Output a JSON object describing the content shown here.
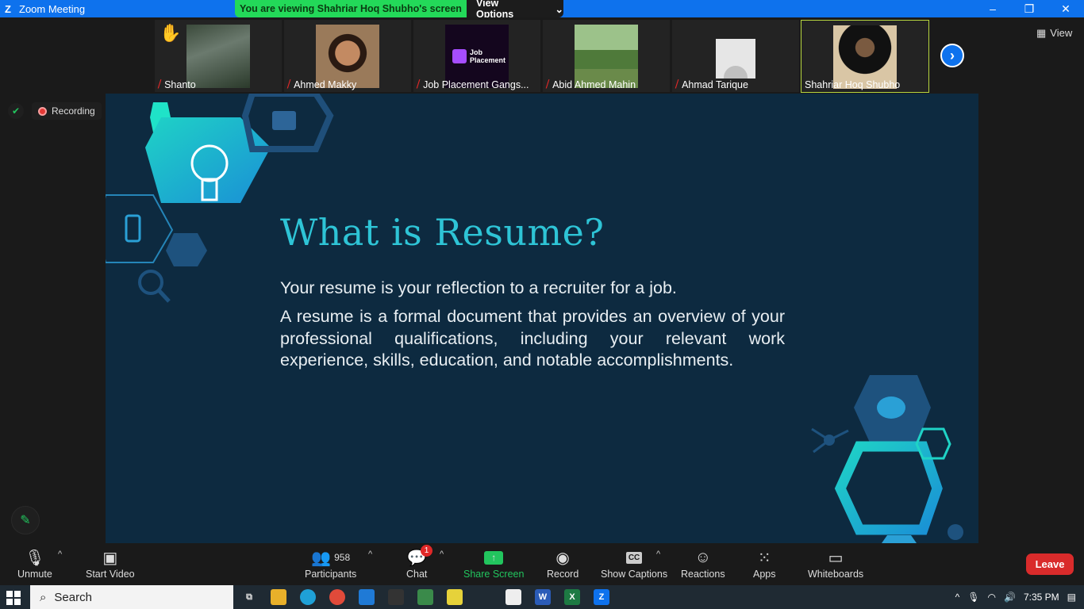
{
  "window": {
    "title": "Zoom Meeting"
  },
  "share_banner": {
    "message": "You are viewing Shahriar Hoq Shubho's screen",
    "view_options": "View Options"
  },
  "view_button": "View",
  "participants_strip": [
    {
      "name": "Shanto",
      "muted": true,
      "hand_raised": true
    },
    {
      "name": "Ahmed Makky",
      "muted": true
    },
    {
      "name": "Job Placement Gangs...",
      "muted": true,
      "logo_text": "Job Placement"
    },
    {
      "name": "Abid Ahmed Mahin",
      "muted": true
    },
    {
      "name": "Ahmad Tarique",
      "muted": true
    },
    {
      "name": "Shahriar Hoq Shubho",
      "muted": false,
      "active": true
    }
  ],
  "recording": {
    "label": "Recording"
  },
  "slide": {
    "title": "What is Resume?",
    "line1": "Your resume is your reflection to a recruiter for a job.",
    "line2": "A resume is a formal document that provides an overview of your professional qualifications, including your relevant work experience, skills, education, and notable accomplishments."
  },
  "toolbar": {
    "unmute": "Unmute",
    "start_video": "Start Video",
    "participants_label": "Participants",
    "participants_count": "958",
    "chat": "Chat",
    "chat_badge": "1",
    "share_screen": "Share Screen",
    "record": "Record",
    "show_captions": "Show Captions",
    "captions_icon": "CC",
    "reactions": "Reactions",
    "apps": "Apps",
    "whiteboards": "Whiteboards",
    "leave": "Leave"
  },
  "taskbar": {
    "search": "Search",
    "time": "7:35 PM"
  },
  "colors": {
    "zoom_blue": "#0e72ed",
    "banner_green": "#23d959",
    "leave_red": "#d92b2b",
    "slide_bg": "#0d2a40",
    "slide_title": "#2ec4d6"
  }
}
